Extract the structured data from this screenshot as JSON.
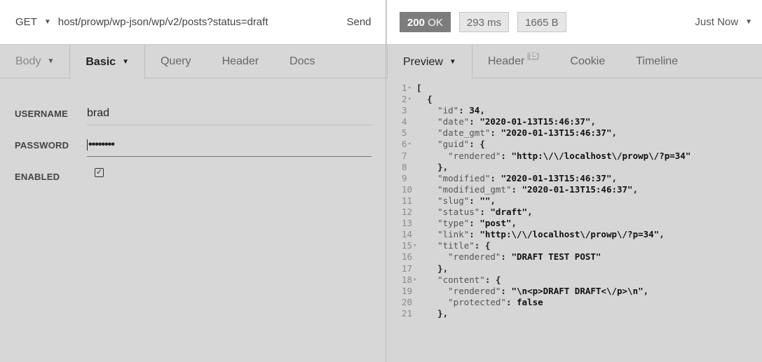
{
  "request": {
    "method": "GET",
    "url": "host/prowp/wp-json/wp/v2/posts?status=draft",
    "send_label": "Send"
  },
  "request_tabs": {
    "body": "Body",
    "basic": "Basic",
    "query": "Query",
    "header": "Header",
    "docs": "Docs"
  },
  "auth": {
    "username_label": "USERNAME",
    "username_value": "brad",
    "password_label": "PASSWORD",
    "password_mask": "••••••••",
    "enabled_label": "ENABLED",
    "enabled_checked": true
  },
  "response": {
    "status_code": "200",
    "status_text": "OK",
    "time": "293 ms",
    "size": "1665 B",
    "when": "Just Now"
  },
  "response_tabs": {
    "preview": "Preview",
    "header": "Header",
    "header_count": "15",
    "cookie": "Cookie",
    "timeline": "Timeline"
  },
  "icons": [
    "dropdown-caret-icon",
    "checkbox-checked-icon",
    "fold-arrow-icon"
  ],
  "code_lines": [
    {
      "n": "1",
      "fold": true,
      "parts": [
        [
          "",
          "p",
          "["
        ]
      ]
    },
    {
      "n": "2",
      "fold": true,
      "parts": [
        [
          "  ",
          "p",
          "{"
        ]
      ]
    },
    {
      "n": "3",
      "fold": false,
      "parts": [
        [
          "    ",
          "k",
          "\"id\""
        ],
        [
          "",
          "p",
          ": "
        ],
        [
          "",
          "v",
          "34"
        ],
        [
          "",
          "p",
          ","
        ]
      ]
    },
    {
      "n": "4",
      "fold": false,
      "parts": [
        [
          "    ",
          "k",
          "\"date\""
        ],
        [
          "",
          "p",
          ": "
        ],
        [
          "",
          "v",
          "\"2020-01-13T15:46:37\""
        ],
        [
          "",
          "p",
          ","
        ]
      ]
    },
    {
      "n": "5",
      "fold": false,
      "parts": [
        [
          "    ",
          "k",
          "\"date_gmt\""
        ],
        [
          "",
          "p",
          ": "
        ],
        [
          "",
          "v",
          "\"2020-01-13T15:46:37\""
        ],
        [
          "",
          "p",
          ","
        ]
      ]
    },
    {
      "n": "6",
      "fold": true,
      "parts": [
        [
          "    ",
          "k",
          "\"guid\""
        ],
        [
          "",
          "p",
          ": {"
        ]
      ]
    },
    {
      "n": "7",
      "fold": false,
      "parts": [
        [
          "      ",
          "k",
          "\"rendered\""
        ],
        [
          "",
          "p",
          ": "
        ],
        [
          "",
          "v",
          "\"http:\\/\\/localhost\\/prowp\\/?p=34\""
        ]
      ]
    },
    {
      "n": "8",
      "fold": false,
      "parts": [
        [
          "    ",
          "p",
          "},"
        ]
      ]
    },
    {
      "n": "9",
      "fold": false,
      "parts": [
        [
          "    ",
          "k",
          "\"modified\""
        ],
        [
          "",
          "p",
          ": "
        ],
        [
          "",
          "v",
          "\"2020-01-13T15:46:37\""
        ],
        [
          "",
          "p",
          ","
        ]
      ]
    },
    {
      "n": "10",
      "fold": false,
      "parts": [
        [
          "    ",
          "k",
          "\"modified_gmt\""
        ],
        [
          "",
          "p",
          ": "
        ],
        [
          "",
          "v",
          "\"2020-01-13T15:46:37\""
        ],
        [
          "",
          "p",
          ","
        ]
      ]
    },
    {
      "n": "11",
      "fold": false,
      "parts": [
        [
          "    ",
          "k",
          "\"slug\""
        ],
        [
          "",
          "p",
          ": "
        ],
        [
          "",
          "v",
          "\"\""
        ],
        [
          "",
          "p",
          ","
        ]
      ]
    },
    {
      "n": "12",
      "fold": false,
      "parts": [
        [
          "    ",
          "k",
          "\"status\""
        ],
        [
          "",
          "p",
          ": "
        ],
        [
          "",
          "v",
          "\"draft\""
        ],
        [
          "",
          "p",
          ","
        ]
      ]
    },
    {
      "n": "13",
      "fold": false,
      "parts": [
        [
          "    ",
          "k",
          "\"type\""
        ],
        [
          "",
          "p",
          ": "
        ],
        [
          "",
          "v",
          "\"post\""
        ],
        [
          "",
          "p",
          ","
        ]
      ]
    },
    {
      "n": "14",
      "fold": false,
      "parts": [
        [
          "    ",
          "k",
          "\"link\""
        ],
        [
          "",
          "p",
          ": "
        ],
        [
          "",
          "v",
          "\"http:\\/\\/localhost\\/prowp\\/?p=34\""
        ],
        [
          "",
          "p",
          ","
        ]
      ]
    },
    {
      "n": "15",
      "fold": true,
      "parts": [
        [
          "    ",
          "k",
          "\"title\""
        ],
        [
          "",
          "p",
          ": {"
        ]
      ]
    },
    {
      "n": "16",
      "fold": false,
      "parts": [
        [
          "      ",
          "k",
          "\"rendered\""
        ],
        [
          "",
          "p",
          ": "
        ],
        [
          "",
          "v",
          "\"DRAFT TEST POST\""
        ]
      ]
    },
    {
      "n": "17",
      "fold": false,
      "parts": [
        [
          "    ",
          "p",
          "},"
        ]
      ]
    },
    {
      "n": "18",
      "fold": true,
      "parts": [
        [
          "    ",
          "k",
          "\"content\""
        ],
        [
          "",
          "p",
          ": {"
        ]
      ]
    },
    {
      "n": "19",
      "fold": false,
      "parts": [
        [
          "      ",
          "k",
          "\"rendered\""
        ],
        [
          "",
          "p",
          ": "
        ],
        [
          "",
          "v",
          "\"\\n<p>DRAFT DRAFT<\\/p>\\n\""
        ],
        [
          "",
          "p",
          ","
        ]
      ]
    },
    {
      "n": "20",
      "fold": false,
      "parts": [
        [
          "      ",
          "k",
          "\"protected\""
        ],
        [
          "",
          "p",
          ": "
        ],
        [
          "",
          "v",
          "false"
        ]
      ]
    },
    {
      "n": "21",
      "fold": false,
      "parts": [
        [
          "    ",
          "p",
          "},"
        ]
      ]
    }
  ]
}
